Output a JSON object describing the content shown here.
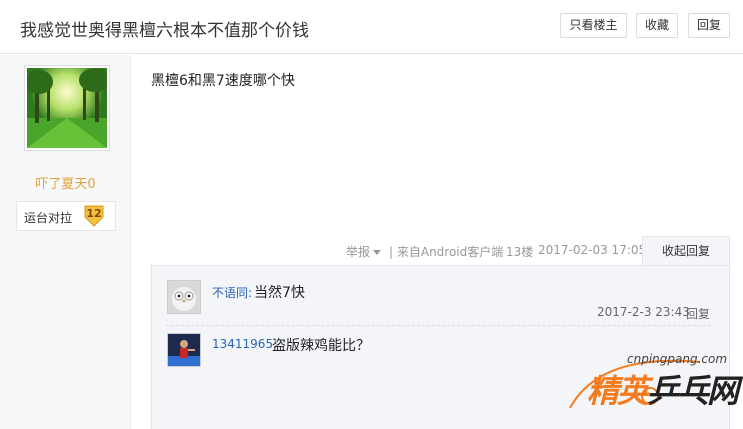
{
  "header": {
    "thread_title": "我感觉世奥得黑檀六根本不值那个价钱",
    "only_author": "只看楼主",
    "favorite": "收藏",
    "reply": "回复"
  },
  "author": {
    "name": "吓了夏天0",
    "bar_name": "运台对拉",
    "level": "12"
  },
  "post": {
    "content": "黑檀6和黑7速度哪个快",
    "report": "举报",
    "separator_source": "| 来自Android客户端",
    "floor": "13楼",
    "time": "2017-02-03 17:05",
    "collapse": "收起回复"
  },
  "replies": [
    {
      "user": "不语同:",
      "text": "当然7快",
      "time": "2017-2-3 23:43",
      "reply": "回复"
    },
    {
      "user": "13411965:",
      "text": "盗版辣鸡能比？"
    }
  ],
  "watermark": {
    "url": "cnpingpang.com",
    "text_a": "精英",
    "text_b": "乒乓网"
  },
  "colors": {
    "username": "#e3a33b",
    "link_blue": "#2d64b3",
    "reply_bg": "#f3f5f8",
    "watermark_orange": "#f47b20"
  }
}
